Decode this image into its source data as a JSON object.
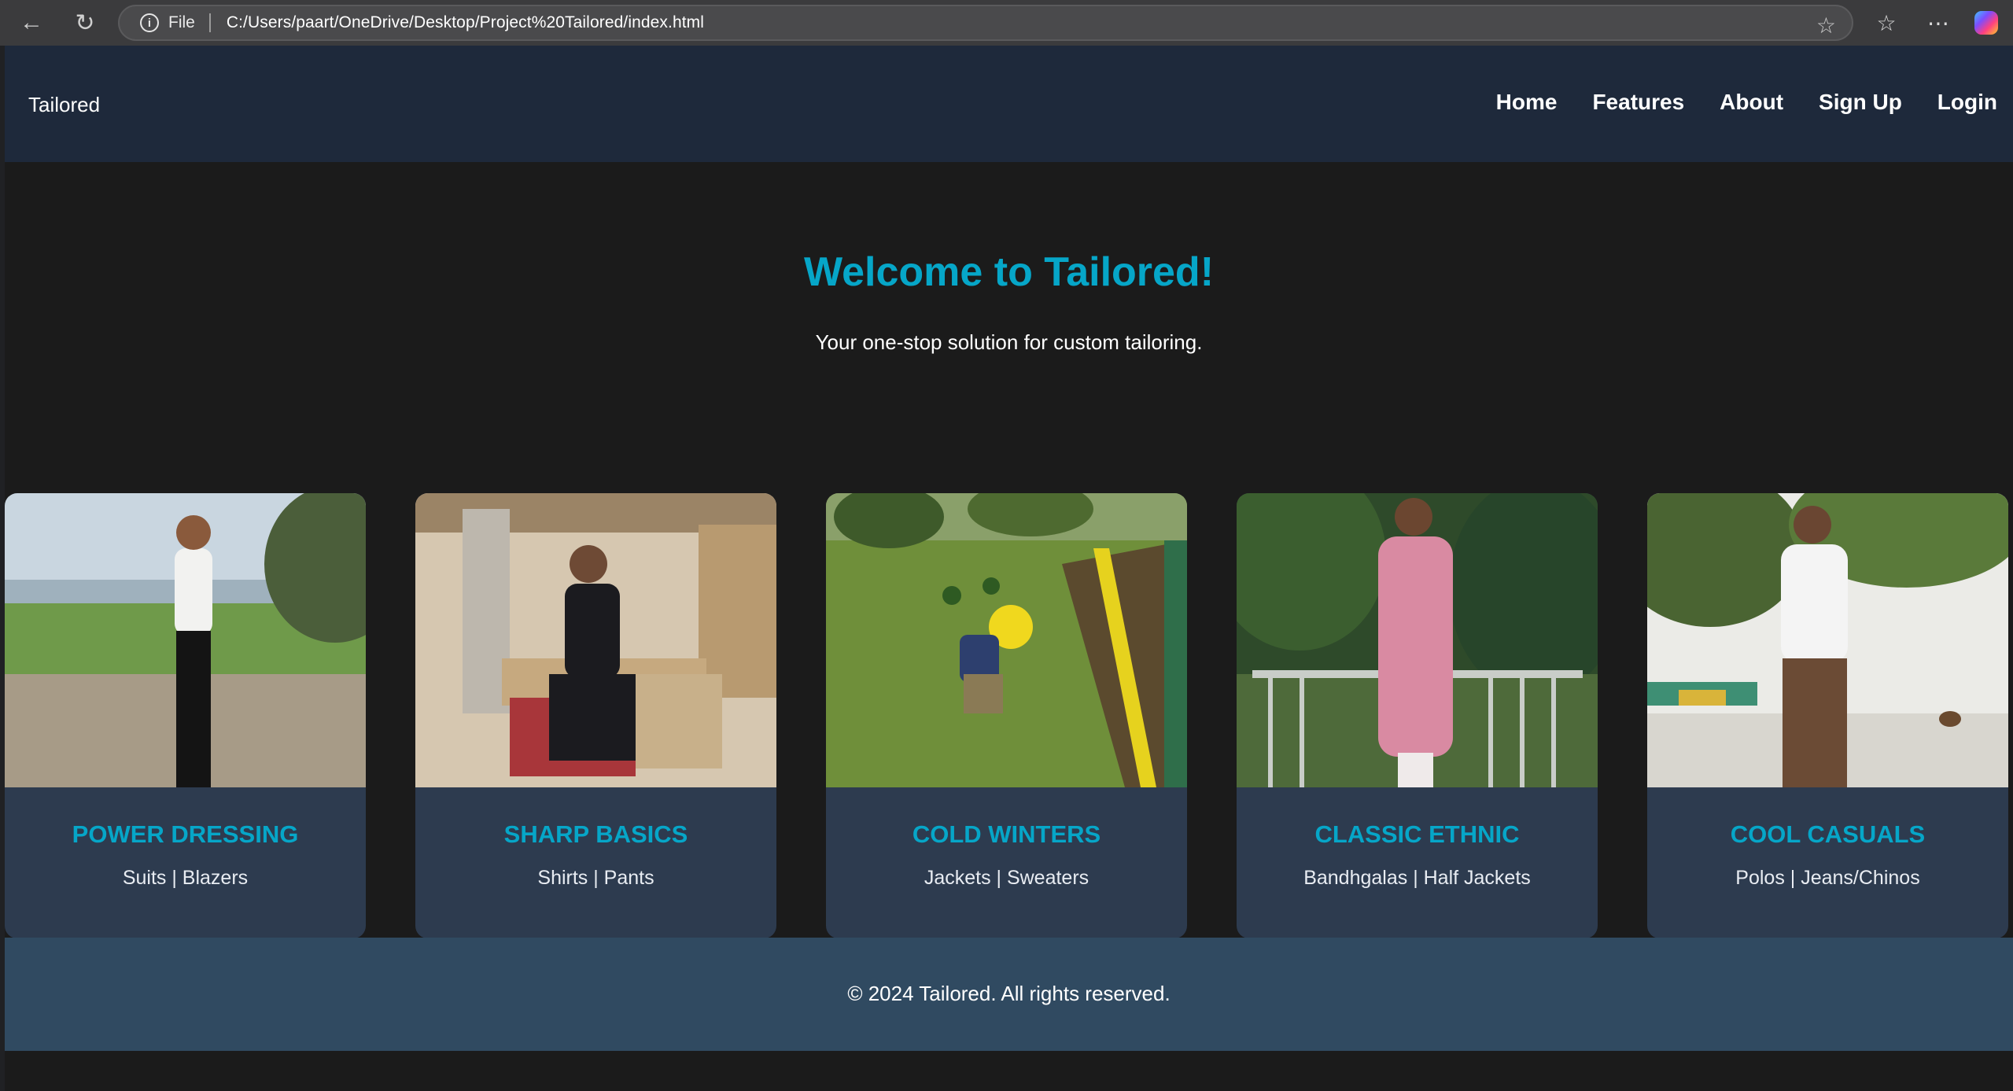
{
  "browser": {
    "file_label": "File",
    "url": "C:/Users/paart/OneDrive/Desktop/Project%20Tailored/index.html"
  },
  "nav": {
    "brand": "Tailored",
    "links": [
      "Home",
      "Features",
      "About",
      "Sign Up",
      "Login"
    ]
  },
  "hero": {
    "title": "Welcome to Tailored!",
    "subtitle": "Your one-stop solution for custom tailoring."
  },
  "cards": [
    {
      "title": "POWER DRESSING",
      "subtitle": "Suits | Blazers"
    },
    {
      "title": "SHARP BASICS",
      "subtitle": "Shirts | Pants"
    },
    {
      "title": "COLD WINTERS",
      "subtitle": "Jackets | Sweaters"
    },
    {
      "title": "CLASSIC ETHNIC",
      "subtitle": "Bandhgalas | Half Jackets"
    },
    {
      "title": "COOL CASUALS",
      "subtitle": "Polos | Jeans/Chinos"
    }
  ],
  "footer": {
    "text": "© 2024 Tailored. All rights reserved."
  },
  "colors": {
    "accent": "#06a6c8",
    "nav_bg": "#1e293b",
    "card_bg": "#2d3b4f",
    "footer_bg": "#304a61"
  }
}
